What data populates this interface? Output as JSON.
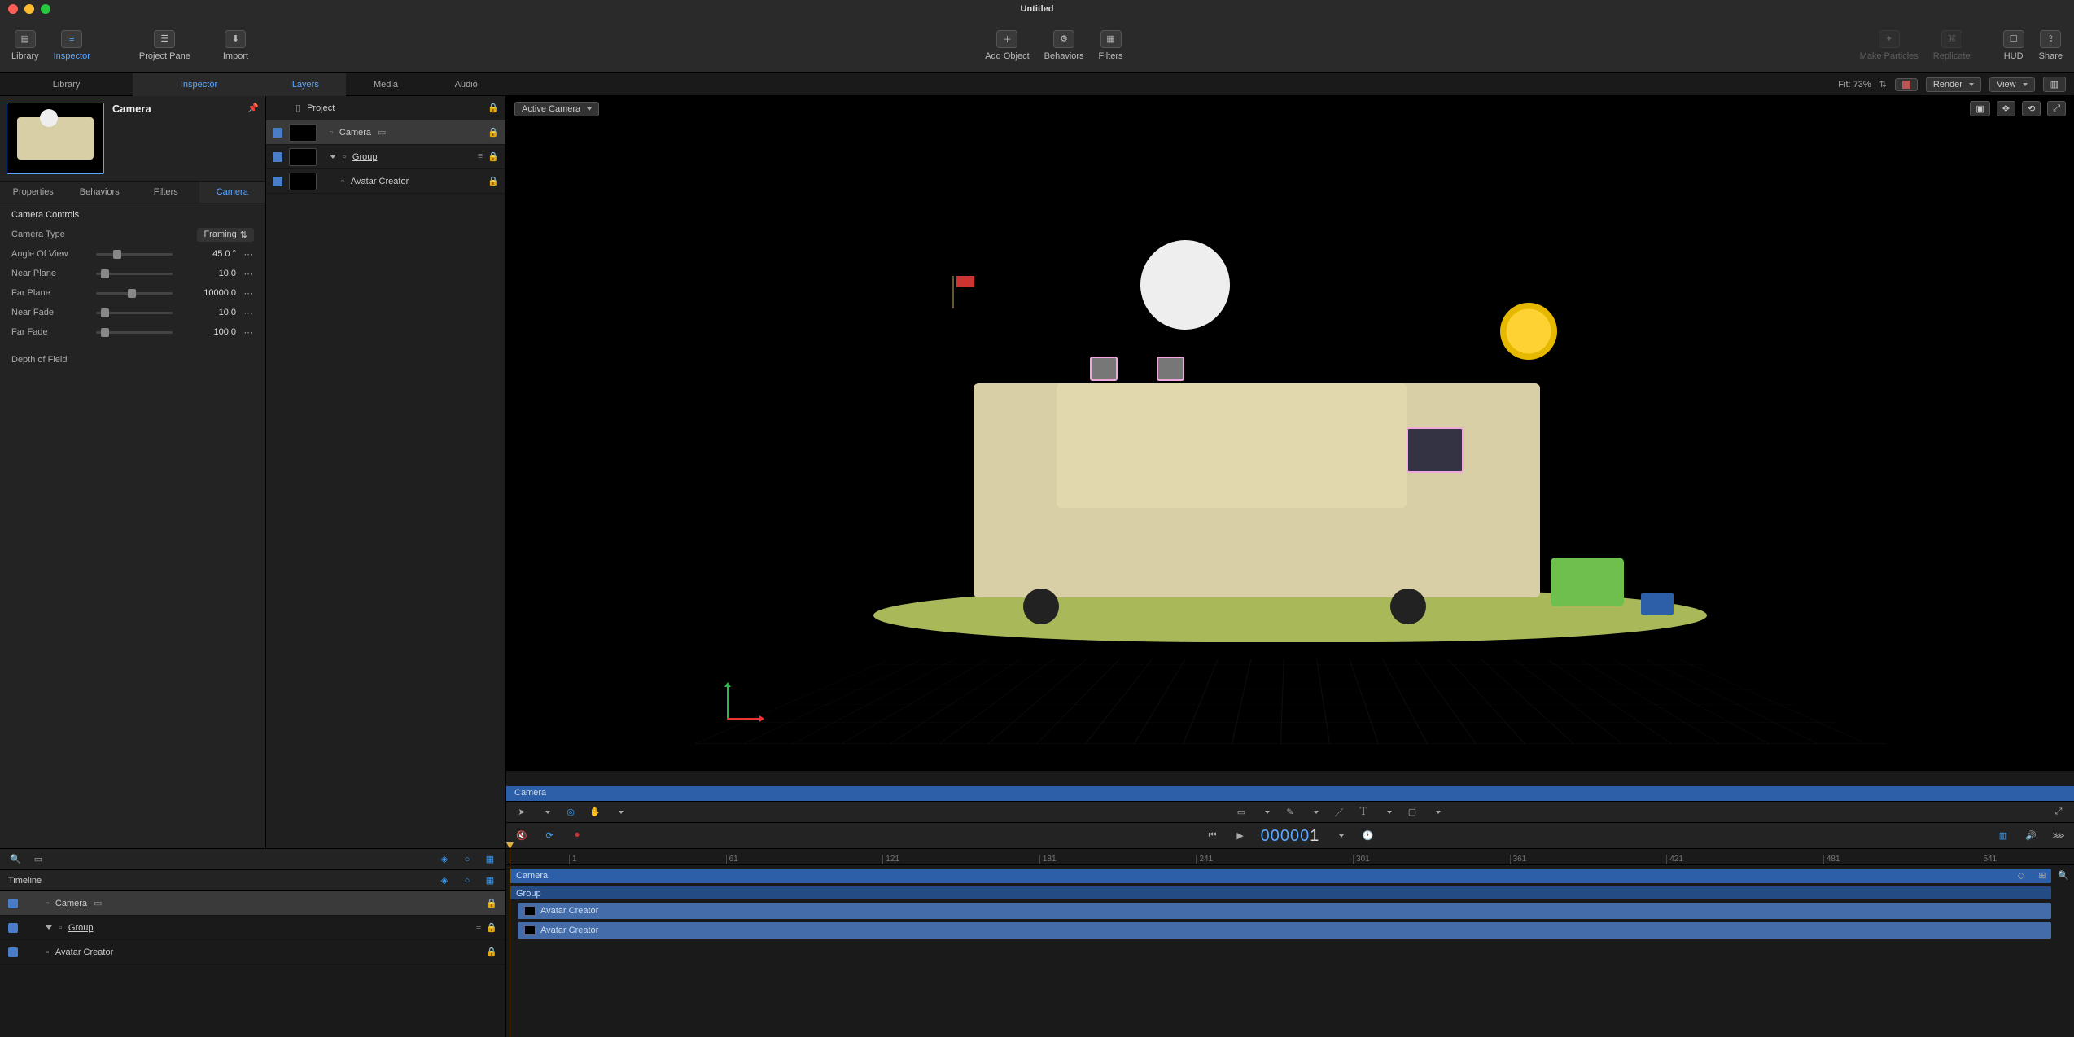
{
  "title": "Untitled",
  "toolbar": {
    "library": "Library",
    "inspector": "Inspector",
    "project_pane": "Project Pane",
    "import": "Import",
    "add_object": "Add Object",
    "behaviors": "Behaviors",
    "filters": "Filters",
    "make_particles": "Make Particles",
    "replicate": "Replicate",
    "hud": "HUD",
    "share": "Share"
  },
  "tabs_left": {
    "library": "Library",
    "inspector": "Inspector"
  },
  "tabs_mid": {
    "layers": "Layers",
    "media": "Media",
    "audio": "Audio"
  },
  "canvas_header": {
    "fit": "Fit: 73%",
    "render": "Render",
    "view": "View",
    "active_camera": "Active Camera"
  },
  "inspector": {
    "object_name": "Camera",
    "tabs": {
      "properties": "Properties",
      "behaviors": "Behaviors",
      "filters": "Filters",
      "camera": "Camera"
    },
    "section_title": "Camera Controls",
    "camera_type_label": "Camera Type",
    "camera_type_value": "Framing",
    "rows": [
      {
        "label": "Angle Of View",
        "value": "45.0",
        "unit": "°",
        "pct": 22
      },
      {
        "label": "Near Plane",
        "value": "10.0",
        "unit": "",
        "pct": 6
      },
      {
        "label": "Far Plane",
        "value": "10000.0",
        "unit": "",
        "pct": 42
      },
      {
        "label": "Near Fade",
        "value": "10.0",
        "unit": "",
        "pct": 6
      },
      {
        "label": "Far Fade",
        "value": "100.0",
        "unit": "",
        "pct": 6
      }
    ],
    "depth_of_field": "Depth of Field"
  },
  "layers": {
    "project": "Project",
    "items": [
      {
        "name": "Camera",
        "selected": true,
        "indent": 0
      },
      {
        "name": "Group",
        "selected": false,
        "indent": 0,
        "underline": true,
        "disclosure": true
      },
      {
        "name": "Avatar Creator",
        "selected": false,
        "indent": 1
      }
    ]
  },
  "mini_strip": {
    "camera": "Camera"
  },
  "transport": {
    "timecode_prefix": "00000",
    "timecode_frame": "1"
  },
  "timeline": {
    "header": "Timeline",
    "rows": [
      {
        "name": "Camera",
        "selected": true
      },
      {
        "name": "Group",
        "underline": true,
        "disclosure": true
      },
      {
        "name": "Avatar Creator"
      }
    ],
    "ruler_ticks": [
      "1",
      "61",
      "121",
      "181",
      "241",
      "301",
      "361",
      "421",
      "481",
      "541"
    ],
    "tracks": {
      "camera": "Camera",
      "group": "Group",
      "avatar1": "Avatar Creator",
      "avatar2": "Avatar Creator"
    }
  }
}
